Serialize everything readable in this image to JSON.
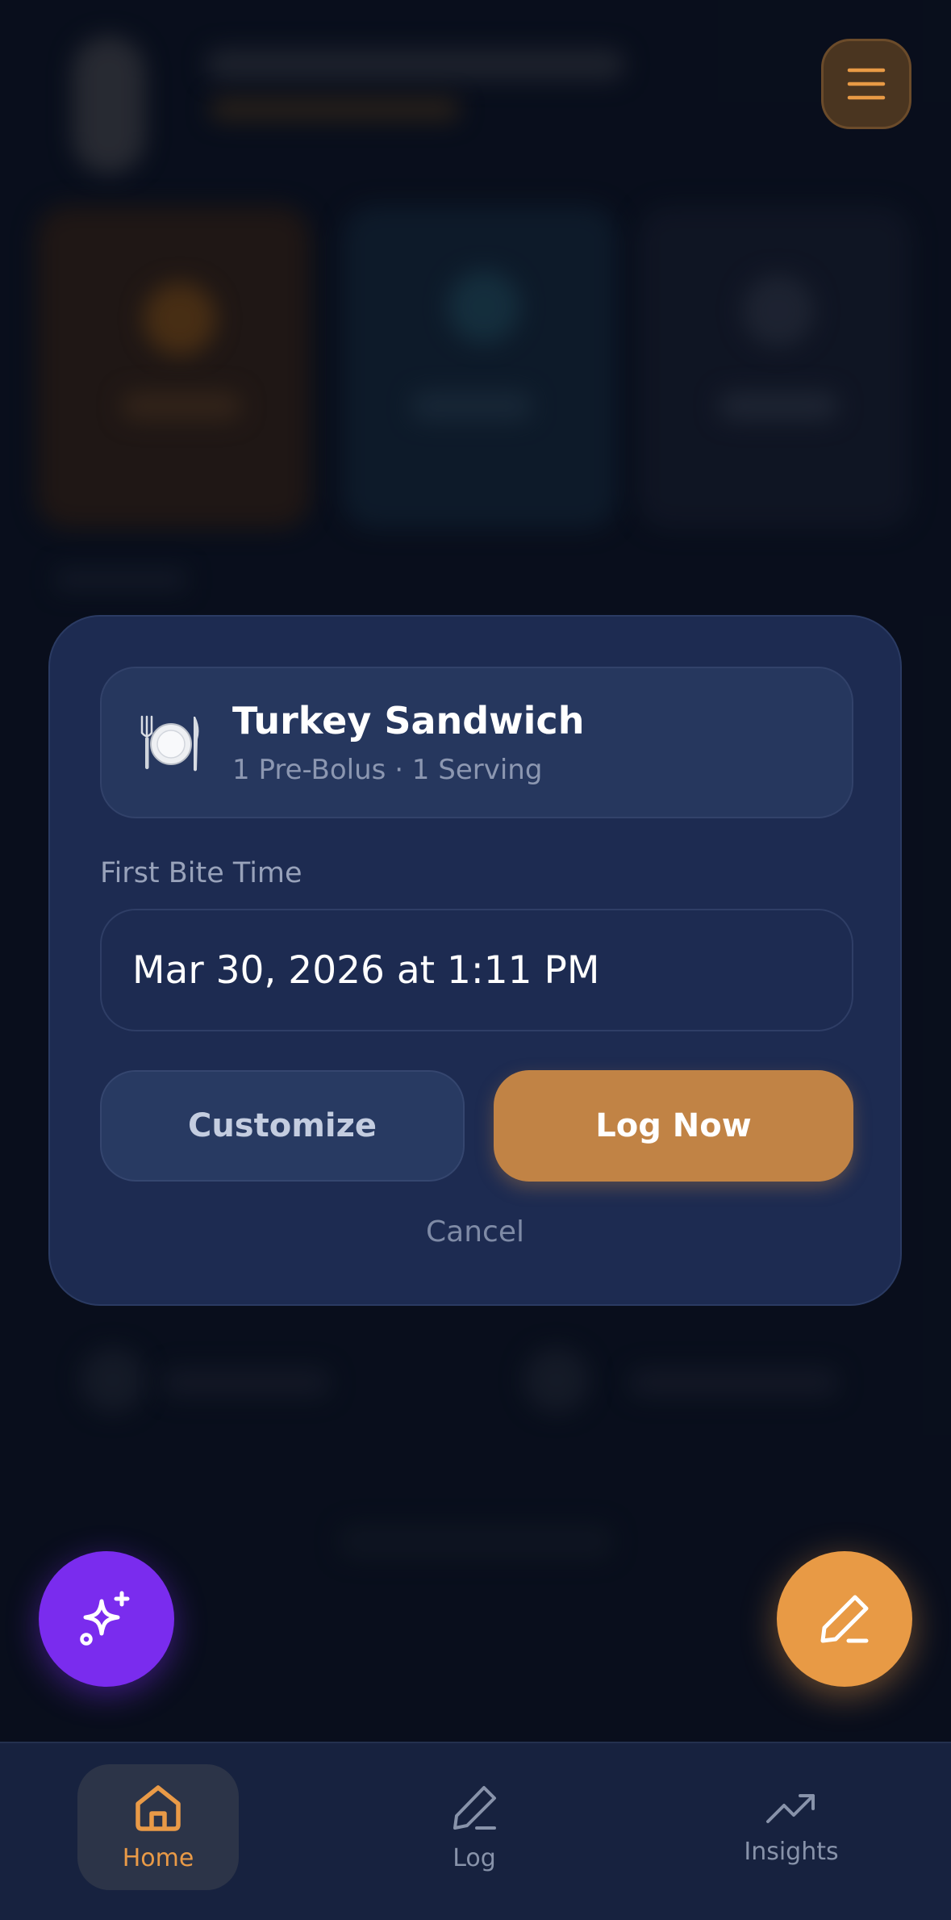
{
  "meal": {
    "icon": "plate-cutlery-icon",
    "name": "Turkey Sandwich",
    "details": "1 Pre-Bolus · 1 Serving"
  },
  "first_bite": {
    "label": "First Bite Time",
    "value": "Mar 30, 2026 at 1:11 PM"
  },
  "actions": {
    "customize": "Customize",
    "log_now": "Log Now",
    "cancel": "Cancel"
  },
  "header": {
    "menu_icon": "hamburger-menu-icon"
  },
  "fabs": {
    "ai": "sparkles-icon",
    "edit": "pencil-icon"
  },
  "tabs": [
    {
      "label": "Home",
      "icon": "home-icon",
      "active": true
    },
    {
      "label": "Log",
      "icon": "pencil-icon",
      "active": false
    },
    {
      "label": "Insights",
      "icon": "trend-up-icon",
      "active": false
    }
  ],
  "colors": {
    "accent": "#e89a45",
    "log_button": "#c18345",
    "ai_button": "#7a2cee",
    "modal": "#1d2b51"
  }
}
